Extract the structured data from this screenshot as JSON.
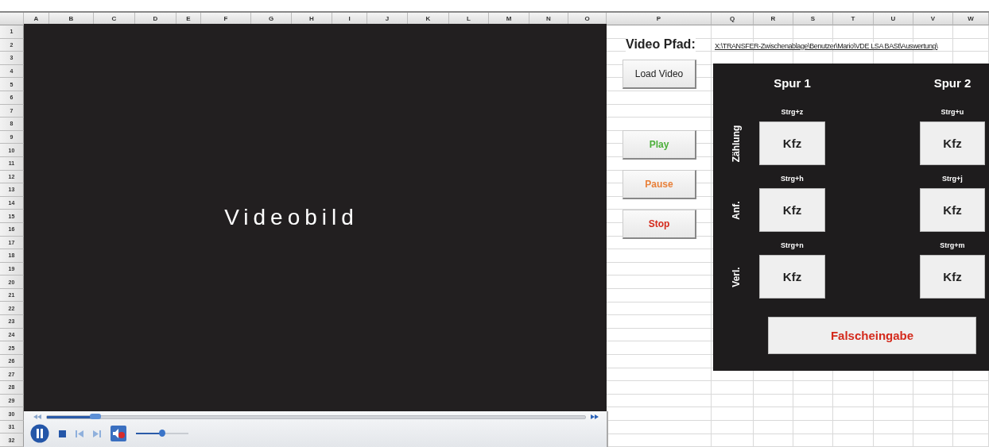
{
  "sheet": {
    "columns": [
      "A",
      "B",
      "C",
      "D",
      "E",
      "F",
      "G",
      "H",
      "I",
      "J",
      "K",
      "L",
      "M",
      "N",
      "O",
      "P",
      "Q",
      "R",
      "S",
      "T",
      "U",
      "V",
      "W"
    ],
    "rows": [
      "1",
      "2",
      "3",
      "4",
      "5",
      "6",
      "7",
      "8",
      "9",
      "10",
      "11",
      "12",
      "13",
      "14",
      "15",
      "16",
      "17",
      "18",
      "19",
      "20",
      "21",
      "22",
      "23",
      "24",
      "25",
      "26",
      "27",
      "28",
      "29",
      "30",
      "31",
      "32"
    ]
  },
  "video": {
    "caption": "Videobild",
    "seek": {
      "level": 0.09
    },
    "volume": {
      "level": 0.5
    }
  },
  "path": {
    "label": "Video Pfad:",
    "value": "X:\\TRANSFER-Zwischenablage\\Benutzer\\Mario\\VDE LSA BASt\\Auswertung\\"
  },
  "buttons": [
    {
      "label": "Load Video",
      "color": "#222222"
    },
    {
      "label": "Play",
      "color": "#4caf3a"
    },
    {
      "label": "Pause",
      "color": "#e8803a"
    },
    {
      "label": "Stop",
      "color": "#d42a1c"
    }
  ],
  "panel": {
    "lanes": [
      "Spur 1",
      "Spur 2"
    ],
    "rows": [
      {
        "label": "Zählung",
        "cells": [
          {
            "shortcut": "Strg+z",
            "button": "Kfz"
          },
          {
            "shortcut": "Strg+u",
            "button": "Kfz"
          }
        ]
      },
      {
        "label": "Anf.",
        "cells": [
          {
            "shortcut": "Strg+h",
            "button": "Kfz"
          },
          {
            "shortcut": "Strg+j",
            "button": "Kfz"
          }
        ]
      },
      {
        "label": "Verl.",
        "cells": [
          {
            "shortcut": "Strg+n",
            "button": "Kfz"
          },
          {
            "shortcut": "Strg+m",
            "button": "Kfz"
          }
        ]
      }
    ],
    "error_button": "Falscheingabe"
  }
}
